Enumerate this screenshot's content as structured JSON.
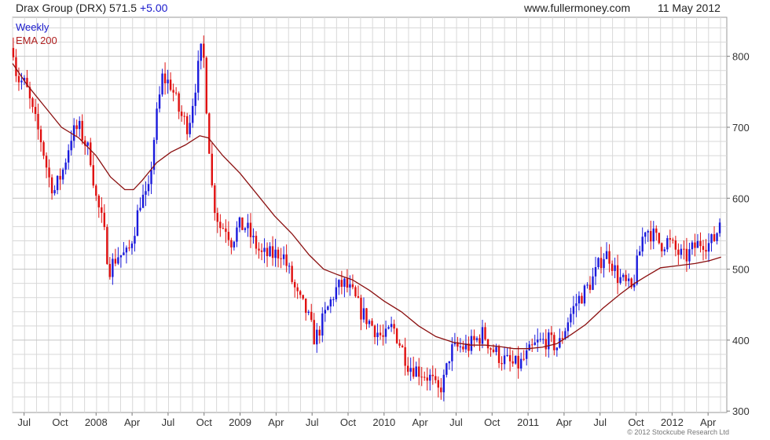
{
  "header": {
    "instrument": "Drax Group (DRX)",
    "last": "571.5",
    "change": "+5.00",
    "site": "www.fullermoney.com",
    "date": "11 May 2012"
  },
  "copyright": "© 2012 Stockcube Research Ltd",
  "colors": {
    "up": "#1a1adc",
    "down": "#e01010",
    "ema": "#8b1010",
    "grid": "#d8d8d8",
    "label_blue": "#1a1acc",
    "label_red": "#b02020"
  },
  "chart_data": {
    "type": "candlestick",
    "frequency_label": "Weekly",
    "indicator_label": "EMA 200",
    "y_ticks": [
      300,
      400,
      500,
      600,
      700,
      800
    ],
    "x_ticks": [
      {
        "label": "Jul",
        "t": 2007.54
      },
      {
        "label": "Oct",
        "t": 2007.79
      },
      {
        "label": "2008",
        "t": 2008.04
      },
      {
        "label": "Apr",
        "t": 2008.29
      },
      {
        "label": "Jul",
        "t": 2008.54
      },
      {
        "label": "Oct",
        "t": 2008.79
      },
      {
        "label": "2009",
        "t": 2009.04
      },
      {
        "label": "Apr",
        "t": 2009.29
      },
      {
        "label": "Jul",
        "t": 2009.54
      },
      {
        "label": "Oct",
        "t": 2009.79
      },
      {
        "label": "2010",
        "t": 2010.04
      },
      {
        "label": "Apr",
        "t": 2010.29
      },
      {
        "label": "Jul",
        "t": 2010.54
      },
      {
        "label": "Oct",
        "t": 2010.79
      },
      {
        "label": "2011",
        "t": 2011.04
      },
      {
        "label": "Apr",
        "t": 2011.29
      },
      {
        "label": "Jul",
        "t": 2011.54
      },
      {
        "label": "Oct",
        "t": 2011.79
      },
      {
        "label": "2012",
        "t": 2012.04
      },
      {
        "label": "Apr",
        "t": 2012.29
      }
    ],
    "xlim": [
      2007.46,
      2012.42
    ],
    "ylim": [
      298,
      855
    ],
    "grid": true,
    "price_path": [
      [
        2007.46,
        820
      ],
      [
        2007.49,
        770
      ],
      [
        2007.55,
        760
      ],
      [
        2007.6,
        720
      ],
      [
        2007.66,
        680
      ],
      [
        2007.71,
        630
      ],
      [
        2007.75,
        610
      ],
      [
        2007.81,
        640
      ],
      [
        2007.87,
        690
      ],
      [
        2007.92,
        700
      ],
      [
        2007.96,
        680
      ],
      [
        2008.0,
        660
      ],
      [
        2008.04,
        600
      ],
      [
        2008.09,
        560
      ],
      [
        2008.13,
        500
      ],
      [
        2008.19,
        520
      ],
      [
        2008.26,
        520
      ],
      [
        2008.31,
        560
      ],
      [
        2008.35,
        600
      ],
      [
        2008.4,
        600
      ],
      [
        2008.45,
        700
      ],
      [
        2008.5,
        770
      ],
      [
        2008.56,
        760
      ],
      [
        2008.62,
        720
      ],
      [
        2008.68,
        700
      ],
      [
        2008.73,
        760
      ],
      [
        2008.78,
        820
      ],
      [
        2008.81,
        720
      ],
      [
        2008.85,
        600
      ],
      [
        2008.9,
        560
      ],
      [
        2008.94,
        560
      ],
      [
        2008.98,
        540
      ],
      [
        2009.03,
        560
      ],
      [
        2009.08,
        560
      ],
      [
        2009.13,
        540
      ],
      [
        2009.19,
        520
      ],
      [
        2009.27,
        520
      ],
      [
        2009.33,
        525
      ],
      [
        2009.39,
        490
      ],
      [
        2009.44,
        460
      ],
      [
        2009.5,
        440
      ],
      [
        2009.56,
        400
      ],
      [
        2009.62,
        430
      ],
      [
        2009.7,
        470
      ],
      [
        2009.76,
        480
      ],
      [
        2009.82,
        465
      ],
      [
        2009.88,
        440
      ],
      [
        2009.96,
        420
      ],
      [
        2010.04,
        400
      ],
      [
        2010.1,
        420
      ],
      [
        2010.16,
        390
      ],
      [
        2010.21,
        365
      ],
      [
        2010.3,
        355
      ],
      [
        2010.37,
        345
      ],
      [
        2010.41,
        325
      ],
      [
        2010.46,
        345
      ],
      [
        2010.5,
        385
      ],
      [
        2010.56,
        390
      ],
      [
        2010.62,
        390
      ],
      [
        2010.68,
        400
      ],
      [
        2010.73,
        410
      ],
      [
        2010.78,
        390
      ],
      [
        2010.85,
        375
      ],
      [
        2010.93,
        365
      ],
      [
        2010.98,
        365
      ],
      [
        2011.04,
        380
      ],
      [
        2011.1,
        395
      ],
      [
        2011.17,
        400
      ],
      [
        2011.25,
        390
      ],
      [
        2011.32,
        430
      ],
      [
        2011.38,
        455
      ],
      [
        2011.44,
        470
      ],
      [
        2011.5,
        490
      ],
      [
        2011.56,
        520
      ],
      [
        2011.6,
        520
      ],
      [
        2011.66,
        490
      ],
      [
        2011.71,
        480
      ],
      [
        2011.76,
        470
      ],
      [
        2011.8,
        510
      ],
      [
        2011.85,
        560
      ],
      [
        2011.9,
        550
      ],
      [
        2011.96,
        535
      ],
      [
        2012.01,
        540
      ],
      [
        2012.07,
        525
      ],
      [
        2012.13,
        515
      ],
      [
        2012.19,
        530
      ],
      [
        2012.25,
        540
      ],
      [
        2012.3,
        535
      ],
      [
        2012.34,
        545
      ],
      [
        2012.38,
        571.5
      ]
    ],
    "ema_path": [
      [
        2007.46,
        790
      ],
      [
        2007.56,
        760
      ],
      [
        2007.68,
        730
      ],
      [
        2007.8,
        700
      ],
      [
        2007.92,
        685
      ],
      [
        2008.04,
        660
      ],
      [
        2008.14,
        630
      ],
      [
        2008.24,
        612
      ],
      [
        2008.3,
        612
      ],
      [
        2008.36,
        625
      ],
      [
        2008.46,
        650
      ],
      [
        2008.56,
        665
      ],
      [
        2008.66,
        675
      ],
      [
        2008.76,
        688
      ],
      [
        2008.82,
        685
      ],
      [
        2008.92,
        660
      ],
      [
        2009.04,
        635
      ],
      [
        2009.16,
        605
      ],
      [
        2009.28,
        575
      ],
      [
        2009.4,
        550
      ],
      [
        2009.52,
        520
      ],
      [
        2009.62,
        500
      ],
      [
        2009.72,
        492
      ],
      [
        2009.82,
        485
      ],
      [
        2009.94,
        470
      ],
      [
        2010.04,
        455
      ],
      [
        2010.16,
        440
      ],
      [
        2010.28,
        420
      ],
      [
        2010.4,
        405
      ],
      [
        2010.52,
        397
      ],
      [
        2010.64,
        393
      ],
      [
        2010.74,
        393
      ],
      [
        2010.84,
        391
      ],
      [
        2010.94,
        388
      ],
      [
        2011.04,
        388
      ],
      [
        2011.14,
        390
      ],
      [
        2011.24,
        395
      ],
      [
        2011.34,
        408
      ],
      [
        2011.44,
        422
      ],
      [
        2011.56,
        445
      ],
      [
        2011.68,
        465
      ],
      [
        2011.78,
        480
      ],
      [
        2011.86,
        490
      ],
      [
        2011.96,
        502
      ],
      [
        2012.08,
        505
      ],
      [
        2012.2,
        508
      ],
      [
        2012.3,
        512
      ],
      [
        2012.38,
        517
      ]
    ]
  }
}
